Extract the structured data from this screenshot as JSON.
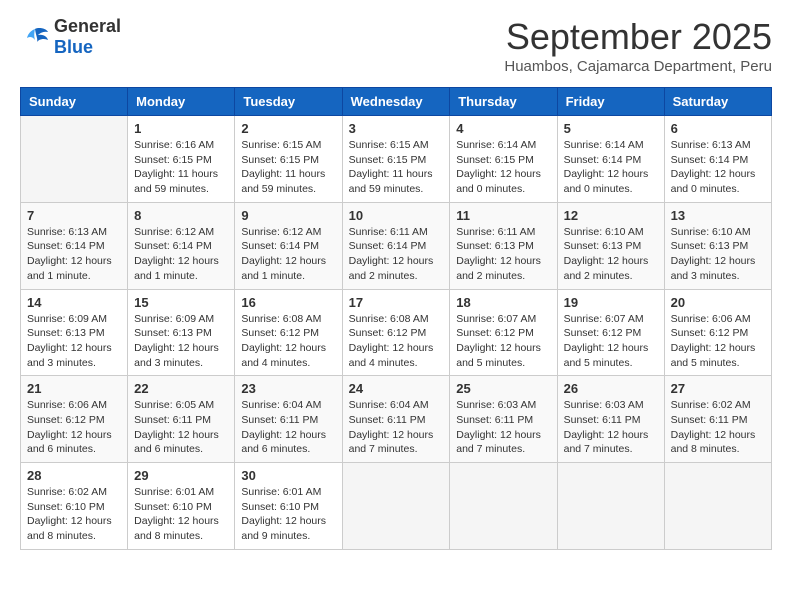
{
  "logo": {
    "general": "General",
    "blue": "Blue"
  },
  "title": "September 2025",
  "subtitle": "Huambos, Cajamarca Department, Peru",
  "days_header": [
    "Sunday",
    "Monday",
    "Tuesday",
    "Wednesday",
    "Thursday",
    "Friday",
    "Saturday"
  ],
  "weeks": [
    [
      {
        "day": "",
        "info": ""
      },
      {
        "day": "1",
        "info": "Sunrise: 6:16 AM\nSunset: 6:15 PM\nDaylight: 11 hours\nand 59 minutes."
      },
      {
        "day": "2",
        "info": "Sunrise: 6:15 AM\nSunset: 6:15 PM\nDaylight: 11 hours\nand 59 minutes."
      },
      {
        "day": "3",
        "info": "Sunrise: 6:15 AM\nSunset: 6:15 PM\nDaylight: 11 hours\nand 59 minutes."
      },
      {
        "day": "4",
        "info": "Sunrise: 6:14 AM\nSunset: 6:15 PM\nDaylight: 12 hours\nand 0 minutes."
      },
      {
        "day": "5",
        "info": "Sunrise: 6:14 AM\nSunset: 6:14 PM\nDaylight: 12 hours\nand 0 minutes."
      },
      {
        "day": "6",
        "info": "Sunrise: 6:13 AM\nSunset: 6:14 PM\nDaylight: 12 hours\nand 0 minutes."
      }
    ],
    [
      {
        "day": "7",
        "info": "Sunrise: 6:13 AM\nSunset: 6:14 PM\nDaylight: 12 hours\nand 1 minute."
      },
      {
        "day": "8",
        "info": "Sunrise: 6:12 AM\nSunset: 6:14 PM\nDaylight: 12 hours\nand 1 minute."
      },
      {
        "day": "9",
        "info": "Sunrise: 6:12 AM\nSunset: 6:14 PM\nDaylight: 12 hours\nand 1 minute."
      },
      {
        "day": "10",
        "info": "Sunrise: 6:11 AM\nSunset: 6:14 PM\nDaylight: 12 hours\nand 2 minutes."
      },
      {
        "day": "11",
        "info": "Sunrise: 6:11 AM\nSunset: 6:13 PM\nDaylight: 12 hours\nand 2 minutes."
      },
      {
        "day": "12",
        "info": "Sunrise: 6:10 AM\nSunset: 6:13 PM\nDaylight: 12 hours\nand 2 minutes."
      },
      {
        "day": "13",
        "info": "Sunrise: 6:10 AM\nSunset: 6:13 PM\nDaylight: 12 hours\nand 3 minutes."
      }
    ],
    [
      {
        "day": "14",
        "info": "Sunrise: 6:09 AM\nSunset: 6:13 PM\nDaylight: 12 hours\nand 3 minutes."
      },
      {
        "day": "15",
        "info": "Sunrise: 6:09 AM\nSunset: 6:13 PM\nDaylight: 12 hours\nand 3 minutes."
      },
      {
        "day": "16",
        "info": "Sunrise: 6:08 AM\nSunset: 6:12 PM\nDaylight: 12 hours\nand 4 minutes."
      },
      {
        "day": "17",
        "info": "Sunrise: 6:08 AM\nSunset: 6:12 PM\nDaylight: 12 hours\nand 4 minutes."
      },
      {
        "day": "18",
        "info": "Sunrise: 6:07 AM\nSunset: 6:12 PM\nDaylight: 12 hours\nand 5 minutes."
      },
      {
        "day": "19",
        "info": "Sunrise: 6:07 AM\nSunset: 6:12 PM\nDaylight: 12 hours\nand 5 minutes."
      },
      {
        "day": "20",
        "info": "Sunrise: 6:06 AM\nSunset: 6:12 PM\nDaylight: 12 hours\nand 5 minutes."
      }
    ],
    [
      {
        "day": "21",
        "info": "Sunrise: 6:06 AM\nSunset: 6:12 PM\nDaylight: 12 hours\nand 6 minutes."
      },
      {
        "day": "22",
        "info": "Sunrise: 6:05 AM\nSunset: 6:11 PM\nDaylight: 12 hours\nand 6 minutes."
      },
      {
        "day": "23",
        "info": "Sunrise: 6:04 AM\nSunset: 6:11 PM\nDaylight: 12 hours\nand 6 minutes."
      },
      {
        "day": "24",
        "info": "Sunrise: 6:04 AM\nSunset: 6:11 PM\nDaylight: 12 hours\nand 7 minutes."
      },
      {
        "day": "25",
        "info": "Sunrise: 6:03 AM\nSunset: 6:11 PM\nDaylight: 12 hours\nand 7 minutes."
      },
      {
        "day": "26",
        "info": "Sunrise: 6:03 AM\nSunset: 6:11 PM\nDaylight: 12 hours\nand 7 minutes."
      },
      {
        "day": "27",
        "info": "Sunrise: 6:02 AM\nSunset: 6:11 PM\nDaylight: 12 hours\nand 8 minutes."
      }
    ],
    [
      {
        "day": "28",
        "info": "Sunrise: 6:02 AM\nSunset: 6:10 PM\nDaylight: 12 hours\nand 8 minutes."
      },
      {
        "day": "29",
        "info": "Sunrise: 6:01 AM\nSunset: 6:10 PM\nDaylight: 12 hours\nand 8 minutes."
      },
      {
        "day": "30",
        "info": "Sunrise: 6:01 AM\nSunset: 6:10 PM\nDaylight: 12 hours\nand 9 minutes."
      },
      {
        "day": "",
        "info": ""
      },
      {
        "day": "",
        "info": ""
      },
      {
        "day": "",
        "info": ""
      },
      {
        "day": "",
        "info": ""
      }
    ]
  ]
}
